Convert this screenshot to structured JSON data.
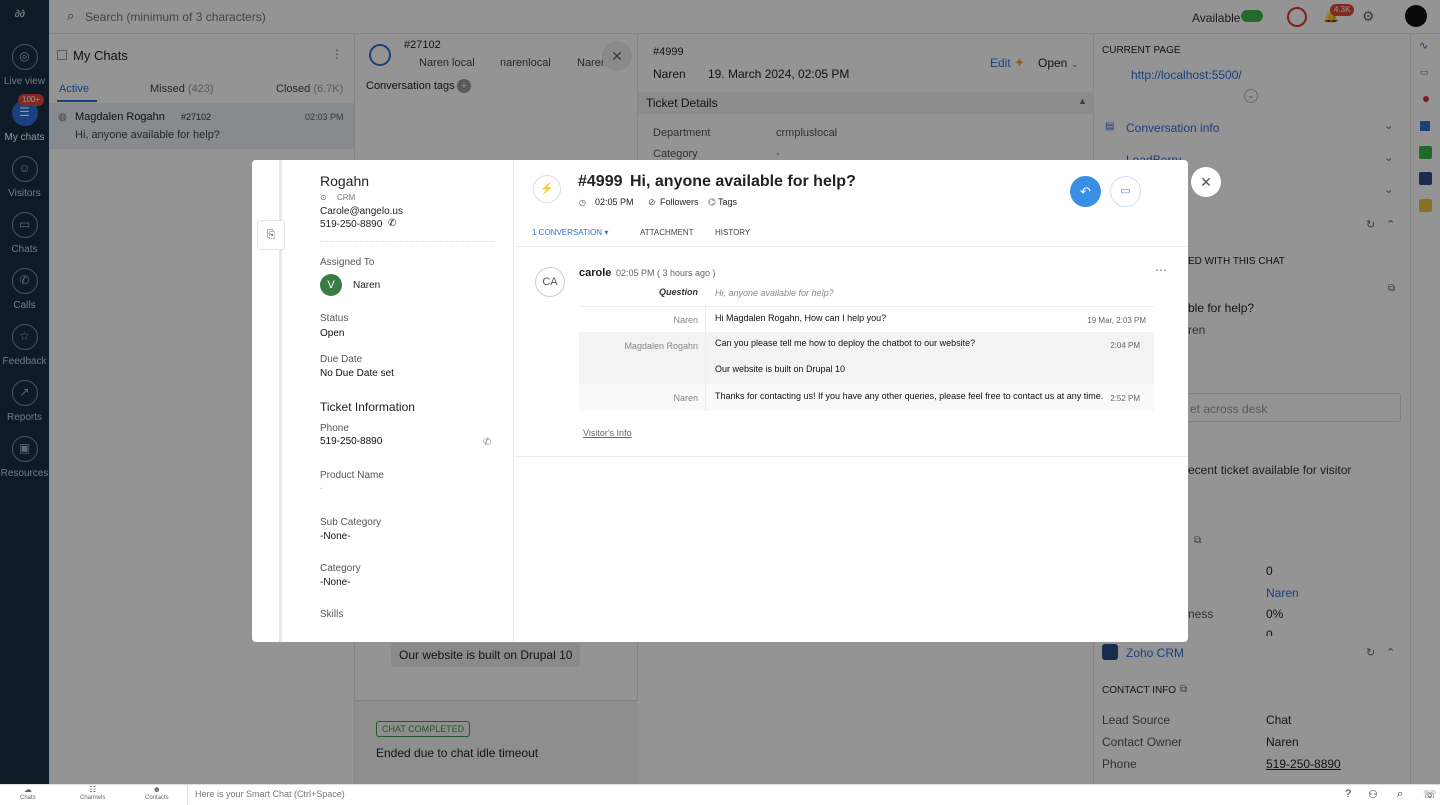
{
  "topbar": {
    "search_placeholder": "Search (minimum of 3 characters)",
    "availability": "Available",
    "notif_count": "4.3K"
  },
  "rail": {
    "items": [
      {
        "label": "Live view"
      },
      {
        "label": "My chats",
        "badge": "100+"
      },
      {
        "label": "Visitors"
      },
      {
        "label": "Chats"
      },
      {
        "label": "Calls"
      },
      {
        "label": "Feedback"
      },
      {
        "label": "Reports"
      },
      {
        "label": "Resources"
      }
    ]
  },
  "chatlist": {
    "title": "My Chats",
    "tabs": {
      "active": "Active",
      "missed": "Missed",
      "missed_count": "(423)",
      "closed": "Closed",
      "closed_count": "(6.7K)"
    },
    "item": {
      "name": "Magdalen Rogahn",
      "id": "#27102",
      "time": "02:03 PM",
      "preview": "Hi, anyone available for help?"
    }
  },
  "conversation": {
    "id": "#27102",
    "agent": "Naren local",
    "dept": "narenlocal",
    "owner": "Naren",
    "tags_label": "Conversation tags",
    "bg_message": "Our website is built on Drupal 10",
    "status_badge": "CHAT COMPLETED",
    "end_note": "Ended due to chat idle timeout"
  },
  "ticket_panel": {
    "id": "#4999",
    "owner": "Naren",
    "date": "19. March 2024, 02:05 PM",
    "edit": "Edit",
    "status": "Open",
    "section": "Ticket Details",
    "rows": [
      {
        "label": "Department",
        "value": "crmpluslocal"
      },
      {
        "label": "Category",
        "value": "-"
      }
    ]
  },
  "right_panel": {
    "current_page_label": "CURRENT PAGE",
    "url": "http://localhost:5500/",
    "conv_info": "Conversation info",
    "leadberry": "LeadBerry",
    "assoc": "ED WITH THIS CHAT",
    "assoc_msg": "ble for help?",
    "assoc_owner": "ren",
    "search_ph": "et across desk",
    "no_ticket": "ecent ticket available for visitor",
    "stats": [
      {
        "v": "0"
      },
      {
        "v": "Naren"
      },
      {
        "label": "ness",
        "v": "0%"
      },
      {
        "v": "0"
      }
    ],
    "zoho": "Zoho CRM",
    "contact_info": "CONTACT INFO",
    "contact_rows": [
      {
        "label": "Lead Source",
        "value": "Chat"
      },
      {
        "label": "Contact Owner",
        "value": "Naren"
      },
      {
        "label": "Phone",
        "value": "519-250-8890"
      }
    ]
  },
  "modal": {
    "contact": {
      "name": "Rogahn",
      "source": "CRM",
      "email": "Carole@angelo.us",
      "phone": "519-250-8890"
    },
    "assigned_label": "Assigned To",
    "assigned": "Naren",
    "status_label": "Status",
    "status": "Open",
    "due_label": "Due Date",
    "due": "No Due Date set",
    "ticket_info": "Ticket Information",
    "fields": [
      {
        "label": "Phone",
        "value": "519-250-8890"
      },
      {
        "label": "Product Name",
        "value": "-"
      },
      {
        "label": "Sub Category",
        "value": "-None-"
      },
      {
        "label": "Category",
        "value": "-None-"
      },
      {
        "label": "Skills",
        "value": ""
      }
    ],
    "ticket_no": "#4999",
    "subject": "Hi, anyone available for help?",
    "time": "02:05 PM",
    "followers": "Followers",
    "tags": "Tags",
    "tabs": [
      "1 CONVERSATION",
      "ATTACHMENT",
      "HISTORY"
    ],
    "thread": {
      "avatar": "CA",
      "author": "carole",
      "when": "02:05 PM ( 3 hours ago )",
      "question_label": "Question",
      "question": "Hi, anyone available for help?",
      "rows": [
        {
          "who": "Naren",
          "msg": "Hi Magdalen Rogahn, How can I help you?",
          "time": "19 Mar, 2:03 PM"
        },
        {
          "who": "Magdalen Rogahn",
          "msg": "Can you please tell me how to deploy the chatbot to our website?",
          "time": "2:04 PM"
        },
        {
          "who": "",
          "msg": "Our website is built on Drupal 10",
          "time": ""
        },
        {
          "who": "Naren",
          "msg": "Thanks for contacting us! If you have any other queries, please feel free to contact us at any time.",
          "time": "2:52 PM"
        }
      ],
      "visitor_info": "Visitor's Info"
    }
  },
  "bottombar": {
    "items": [
      "Chats",
      "Channels",
      "Contacts"
    ],
    "smart_chat": "Here is your Smart Chat (Ctrl+Space)"
  }
}
